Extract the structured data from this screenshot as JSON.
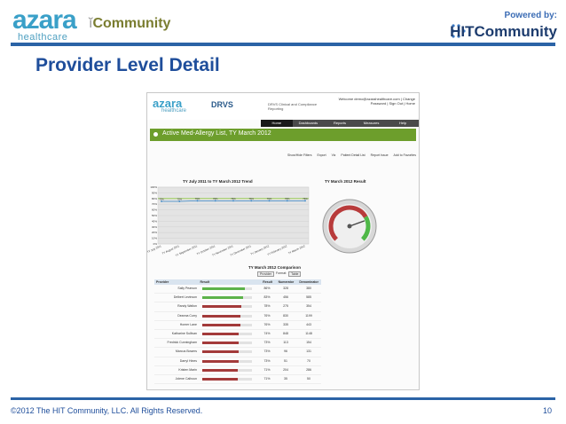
{
  "header": {
    "azara_word": "azara",
    "azara_sub": "healthcare",
    "community_label": "Community",
    "powered_by": "Powered by:",
    "hit_label": "HIT",
    "hit_community": "Community"
  },
  "slide": {
    "title": "Provider Level Detail",
    "footer": "©2012 The HIT Community, LLC. All Rights Reserved.",
    "page_number": "10"
  },
  "embedded": {
    "logo_word": "azara",
    "logo_sub": "healthcare",
    "app_name": "DRVS",
    "app_desc": "DRVS Clinical and Compliance Reporting",
    "welcome": "Welcome demo@azarahealthcare.com | Change",
    "welcome_links": "Password | Sign Out | Home",
    "nav": [
      "Home",
      "Dashboards",
      "Reports",
      "Measures",
      "Help"
    ],
    "report_title": "Active Med-Allergy List, TY March 2012",
    "toolbar": [
      "Show/Hide Filters",
      "Export",
      "Viz",
      "Patient Detail List",
      "Report Issue",
      "Add to Favorites"
    ],
    "trend_title": "TY July 2011 to TY March 2012 Trend",
    "result_title": "TY March 2012 Result",
    "comparison_title": "TY March 2012 Comparison",
    "comparison_controls": {
      "group_value": "Provider",
      "format_label": "Format:",
      "format_value": "Table"
    },
    "table_headers": [
      "Provider",
      "Result",
      "Result",
      "Numerator",
      "Denominator"
    ],
    "rows": [
      {
        "provider": "Sally Pearson",
        "result": "86%",
        "numerator": "328",
        "denominator": "380",
        "color": "#5db34a",
        "pct": 0.86
      },
      {
        "provider": "Delbert Levinson",
        "result": "83%",
        "numerator": "456",
        "denominator": "585",
        "color": "#5db34a",
        "pct": 0.83
      },
      {
        "provider": "Randy Walton",
        "result": "78%",
        "numerator": "275",
        "denominator": "354",
        "color": "#a33a3a",
        "pct": 0.78
      },
      {
        "provider": "Deanna Curry",
        "result": "76%",
        "numerator": "830",
        "denominator": "1199",
        "color": "#a33a3a",
        "pct": 0.76
      },
      {
        "provider": "Homer Lane",
        "result": "76%",
        "numerator": "335",
        "denominator": "443",
        "color": "#a33a3a",
        "pct": 0.76
      },
      {
        "provider": "Katharine Sullivan",
        "result": "74%",
        "numerator": "848",
        "denominator": "1148",
        "color": "#a33a3a",
        "pct": 0.74
      },
      {
        "provider": "Fredrick Cunningham",
        "result": "73%",
        "numerator": "113",
        "denominator": "154",
        "color": "#a33a3a",
        "pct": 0.73
      },
      {
        "provider": "Marcus Bowers",
        "result": "73%",
        "numerator": "96",
        "denominator": "131",
        "color": "#a33a3a",
        "pct": 0.73
      },
      {
        "provider": "Darryl Hines",
        "result": "73%",
        "numerator": "51",
        "denominator": "70",
        "color": "#a33a3a",
        "pct": 0.73
      },
      {
        "provider": "Kristen Marin",
        "result": "71%",
        "numerator": "204",
        "denominator": "286",
        "color": "#a33a3a",
        "pct": 0.71
      },
      {
        "provider": "Jolene Calhoun",
        "result": "71%",
        "numerator": "35",
        "denominator": "50",
        "color": "#a33a3a",
        "pct": 0.71
      }
    ]
  },
  "chart_data": {
    "type": "line",
    "title": "TY July 2011 to TY March 2012 Trend",
    "xlabel": "",
    "ylabel": "",
    "categories": [
      "TY July 2011",
      "TY August 2011",
      "TY September 2011",
      "TY October 2011",
      "TY November 2011",
      "TY December 2011",
      "TY January 2012",
      "TY February 2012",
      "TY March 2012"
    ],
    "yticks": [
      "100%",
      "90%",
      "80%",
      "70%",
      "60%",
      "50%",
      "40%",
      "30%",
      "20%",
      "10%",
      "0%"
    ],
    "ylim": [
      0,
      100
    ],
    "series": [
      {
        "values": [
          75,
          75,
          76,
          76,
          76,
          76,
          76,
          76,
          76
        ],
        "data_labels": [
          "75%",
          "75%",
          "76%",
          "76%",
          "76%",
          "76%",
          "76%",
          "76%",
          "76%"
        ]
      }
    ],
    "colors": {
      "line": "#2f7fc1",
      "target": "#8cc63f"
    },
    "grid": true
  },
  "gauge": {
    "value": 76,
    "min": 0,
    "max": 100
  }
}
